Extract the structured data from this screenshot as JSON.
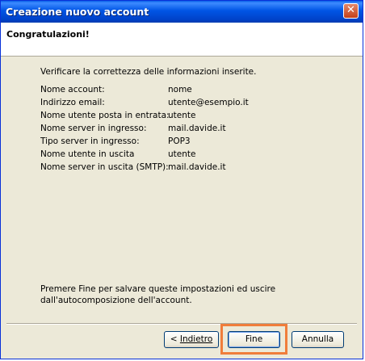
{
  "window": {
    "title": "Creazione nuovo account"
  },
  "header": {
    "title": "Congratulazioni!"
  },
  "intro": "Verificare la correttezza delle informazioni inserite.",
  "fields": [
    {
      "label": "Nome account:",
      "value": "nome"
    },
    {
      "label": "Indirizzo email:",
      "value": "utente@esempio.it"
    },
    {
      "label": "Nome utente posta in entrata:",
      "value": "utente"
    },
    {
      "label": "Nome server in ingresso:",
      "value": "mail.davide.it"
    },
    {
      "label": "Tipo server in ingresso:",
      "value": "POP3"
    },
    {
      "label": "Nome utente in uscita",
      "value": "utente"
    },
    {
      "label": "Nome server in uscita (SMTP):",
      "value": "mail.davide.it"
    }
  ],
  "footer": {
    "line1": "Premere Fine per salvare queste impostazioni ed uscire",
    "line2": "dall'autocomposizione dell'account."
  },
  "buttons": {
    "back_prefix": "< ",
    "back_label": "Indietro",
    "finish": "Fine",
    "cancel": "Annulla"
  },
  "colors": {
    "titlebar": "#0055e5",
    "highlight": "#f07d3b",
    "dialog_bg": "#ece9d8"
  }
}
